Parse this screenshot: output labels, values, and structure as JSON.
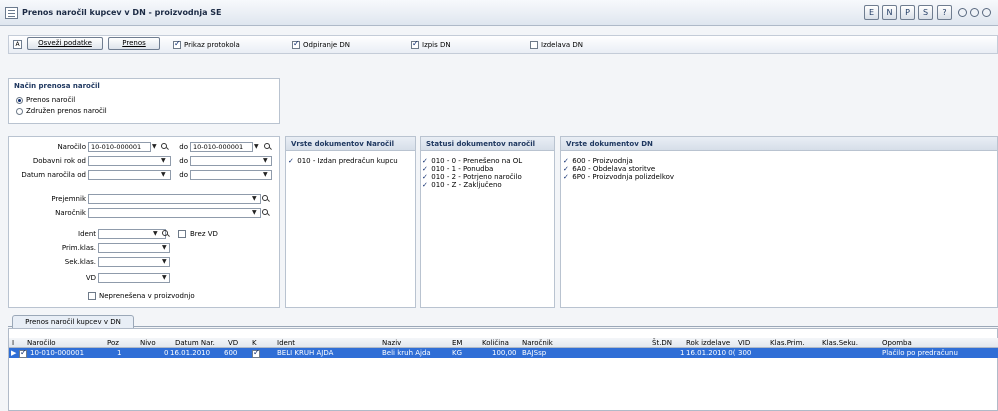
{
  "title": "Prenos naročil kupcev v DN - proizvodnja SE",
  "title_buttons": [
    "E",
    "N",
    "P",
    "S",
    "?"
  ],
  "toolbar": {
    "refresh": "Osveži podatke",
    "transfer": "Prenos",
    "checks": [
      {
        "label": "Prikaz protokola",
        "checked": true
      },
      {
        "label": "Odpiranje DN",
        "checked": true
      },
      {
        "label": "Izpis DN",
        "checked": true
      },
      {
        "label": "Izdelava DN",
        "checked": false
      }
    ]
  },
  "method": {
    "header": "Način prenosa naročil",
    "options": [
      {
        "label": "Prenos naročil",
        "selected": true
      },
      {
        "label": "Združen prenos naročil",
        "selected": false
      }
    ]
  },
  "filters": {
    "narocilo_label": "Naročilo",
    "narocilo_from": "10-010-000001",
    "do1": "do",
    "narocilo_to": "10-010-000001",
    "dobavni_label": "Dobavni rok od",
    "do2": "do",
    "datum_label": "Datum naročila od",
    "do3": "do",
    "prejemnik_label": "Prejemnik",
    "narocnik_label": "Naročnik",
    "ident_label": "Ident",
    "brez_vd": "Brez VD",
    "primklas_label": "Prim.klas.",
    "sekklas_label": "Sek.klas.",
    "vd_label": "VD",
    "neprenesena": "Neprenešena v proizvodnjo"
  },
  "vrste_narocil": {
    "header": "Vrste dokumentov Naročil",
    "items": [
      "010 - Izdan predračun kupcu"
    ]
  },
  "statusi": {
    "header": "Statusi dokumentov naročil",
    "items": [
      "010 - 0 - Prenešeno na OL",
      "010 - 1 - Ponudba",
      "010 - 2 - Potrjeno naročilo",
      "010 - Z - Zaključeno"
    ]
  },
  "vrste_dn": {
    "header": "Vrste dokumentov DN",
    "items": [
      "600 - Proizvodnja",
      "6A0 - Obdelava storitve",
      "6P0 - Proizvodnja polizdelkov"
    ]
  },
  "tab": "Prenos naročil kupcev v DN",
  "grid": {
    "headers": [
      "I",
      "Naročilo",
      "Poz",
      "Nivo",
      "Datum Nar.",
      "VD",
      "K",
      "Ident",
      "Naziv",
      "EM",
      "Količina",
      "Naročnik",
      "Št.DN",
      "Rok izdelave",
      "VID",
      "Klas.Prim.",
      "Klas.Seku.",
      "Opomba"
    ],
    "row": [
      "10-010-000001",
      "1",
      "0",
      "16.01.2010",
      "600",
      "BELI KRUH AJDA",
      "Beli kruh Ajda",
      "KG",
      "100,00",
      "BAJSsp",
      "1",
      "16.01.2010 0(",
      "300",
      "Plačilo po predračunu"
    ]
  }
}
